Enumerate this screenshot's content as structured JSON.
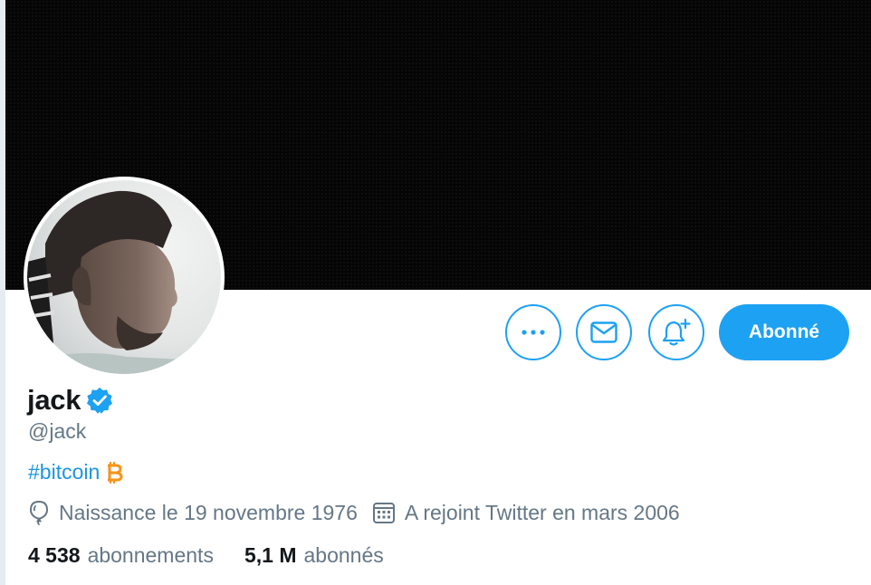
{
  "profile": {
    "name": "jack",
    "handle": "@jack",
    "bio_hashtag": "#bitcoin",
    "birth": "Naissance le 19 novembre 1976",
    "joined": "A rejoint Twitter en mars 2006",
    "following_count": "4 538",
    "following_label": "abonnements",
    "followers_count": "5,1 M",
    "followers_label": "abonnés"
  },
  "actions": {
    "follow_label": "Abonné",
    "more_icon": "more-horizontal-icon",
    "message_icon": "envelope-icon",
    "notifications_icon": "bell-plus-icon"
  },
  "colors": {
    "accent": "#1da1f2",
    "link": "#1b95e0",
    "bitcoin": "#f7931a",
    "secondary_text": "#657786",
    "banner": "#050505"
  }
}
